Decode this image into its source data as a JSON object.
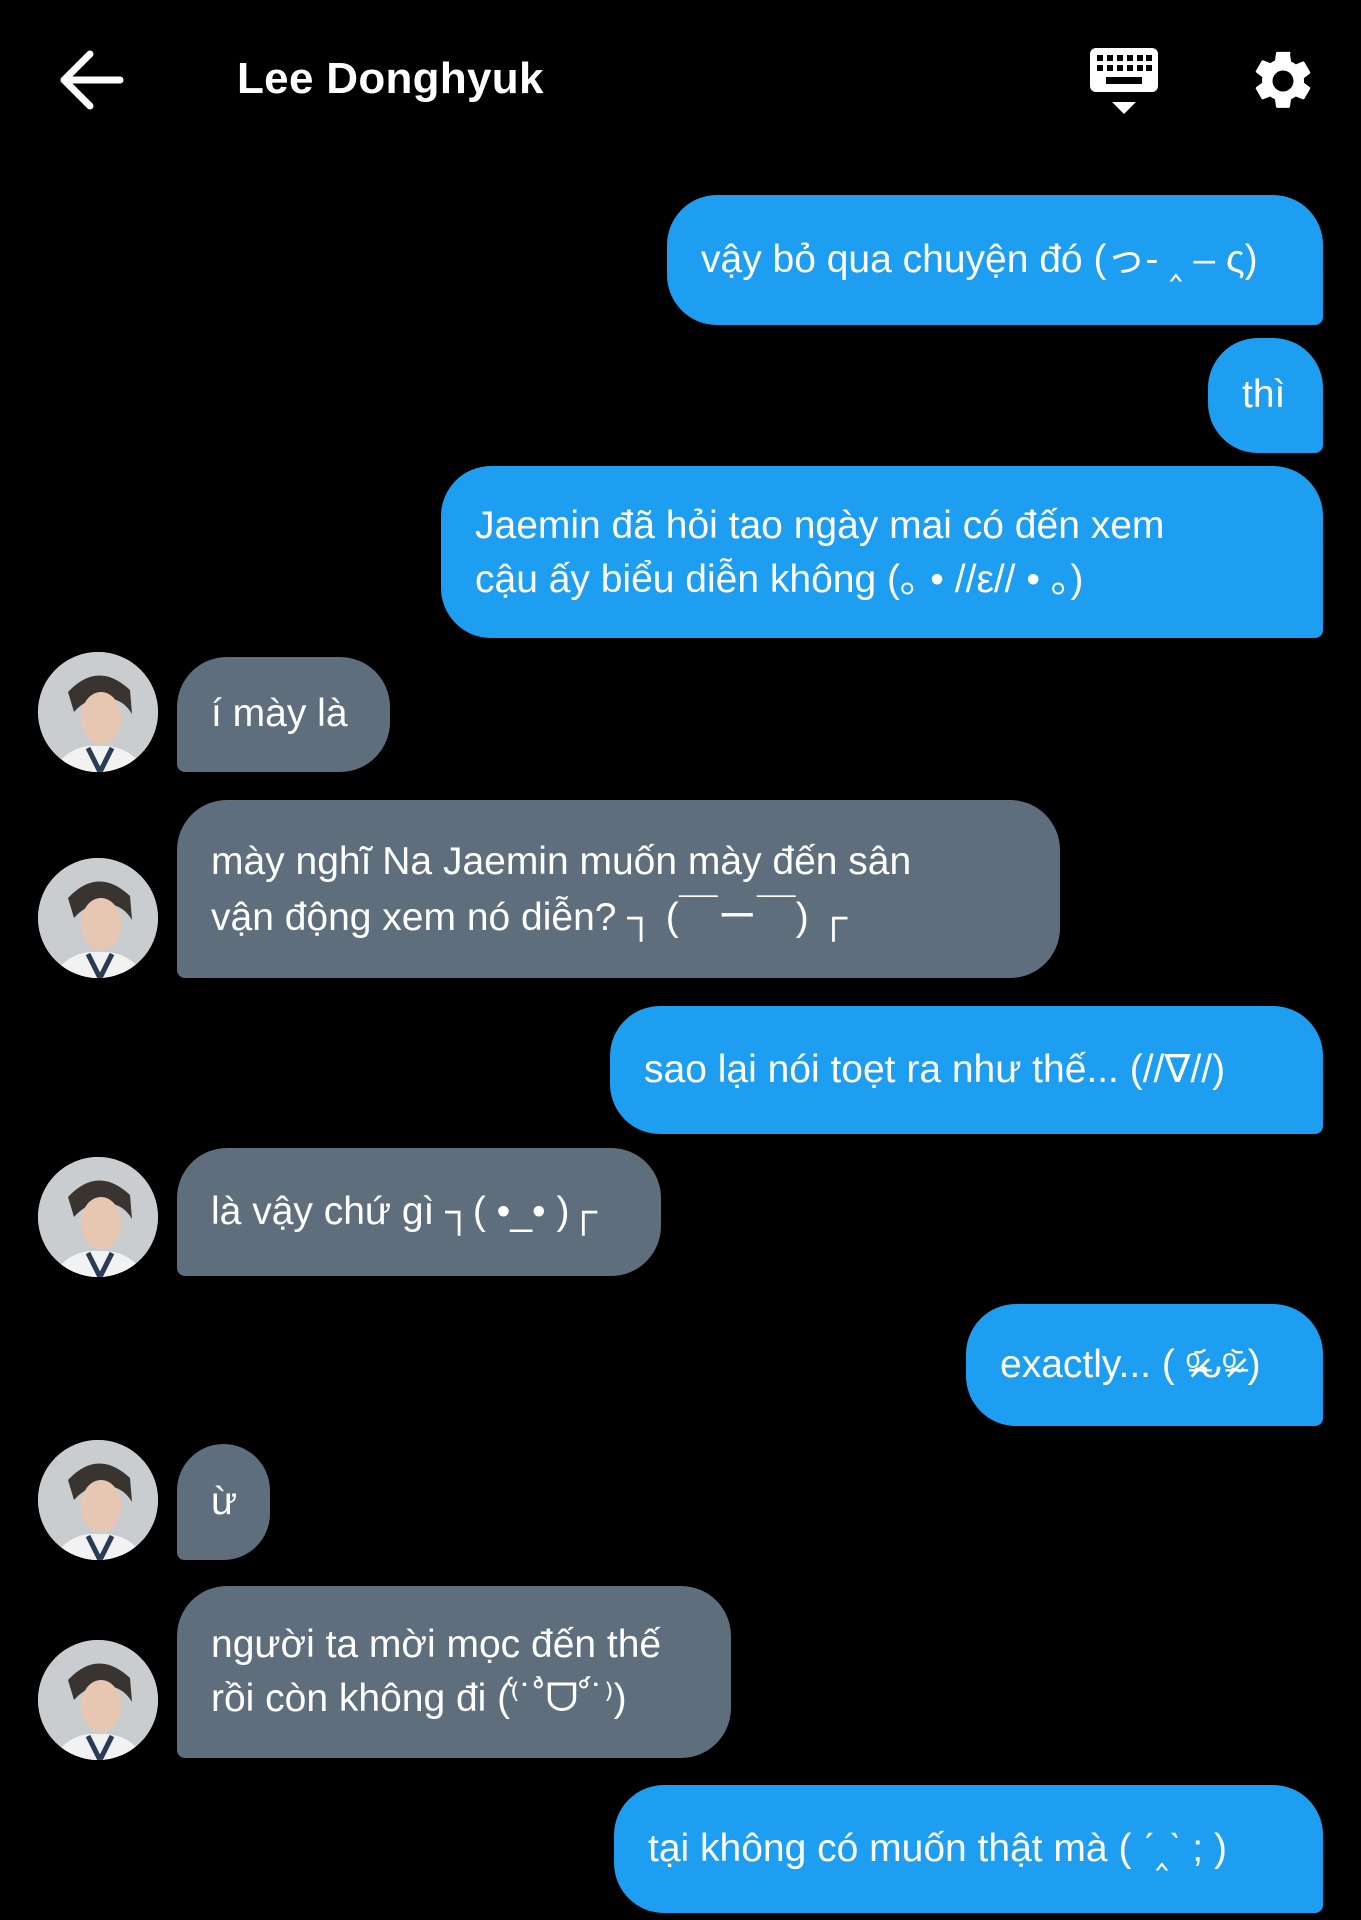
{
  "header": {
    "title": "Lee Donghyuk",
    "back_icon": "arrow-left-icon",
    "keyboard_icon": "keyboard-hide-icon",
    "settings_icon": "gear-icon"
  },
  "colors": {
    "background": "#000000",
    "outgoing_bubble": "#1e9ef0",
    "incoming_bubble": "#5f6e7c",
    "text": "#ffffff"
  },
  "messages": [
    {
      "sender": "me",
      "lines": [
        "vậy bỏ qua chuyện đó (っ- ‸ – ς)"
      ]
    },
    {
      "sender": "me",
      "lines": [
        "thì"
      ]
    },
    {
      "sender": "me",
      "lines": [
        "Jaemin đã hỏi tao ngày mai có đến xem",
        "cậu ấy biểu diễn không (｡ • //ε// • ｡)"
      ]
    },
    {
      "sender": "them",
      "lines": [
        "í mày là"
      ]
    },
    {
      "sender": "them",
      "lines": [
        "mày nghĩ Na Jaemin muốn mày đến sân",
        "vận động xem nó diễn? ┐ (￣ー￣) ┌"
      ]
    },
    {
      "sender": "me",
      "lines": [
        "sao lại nói toẹt ra như thế... (//∇//)"
      ]
    },
    {
      "sender": "them",
      "lines": [
        "là vậy chứ gì ┐( •_• )┌"
      ]
    },
    {
      "sender": "me",
      "lines": [
        "exactly... ( ᵒ̴̶̷᷄ᴗᵒ̴̶̷᷅ )"
      ]
    },
    {
      "sender": "them",
      "lines": [
        "ừ"
      ]
    },
    {
      "sender": "them",
      "lines": [
        "người ta mời mọc đến thế",
        "rồi còn không đi (⁽͑˙˚̀ᗜ˚́˙⁾)"
      ]
    },
    {
      "sender": "me",
      "lines": [
        "tại không có muốn thật mà ( ˊ‸ˋ ; )"
      ]
    }
  ]
}
